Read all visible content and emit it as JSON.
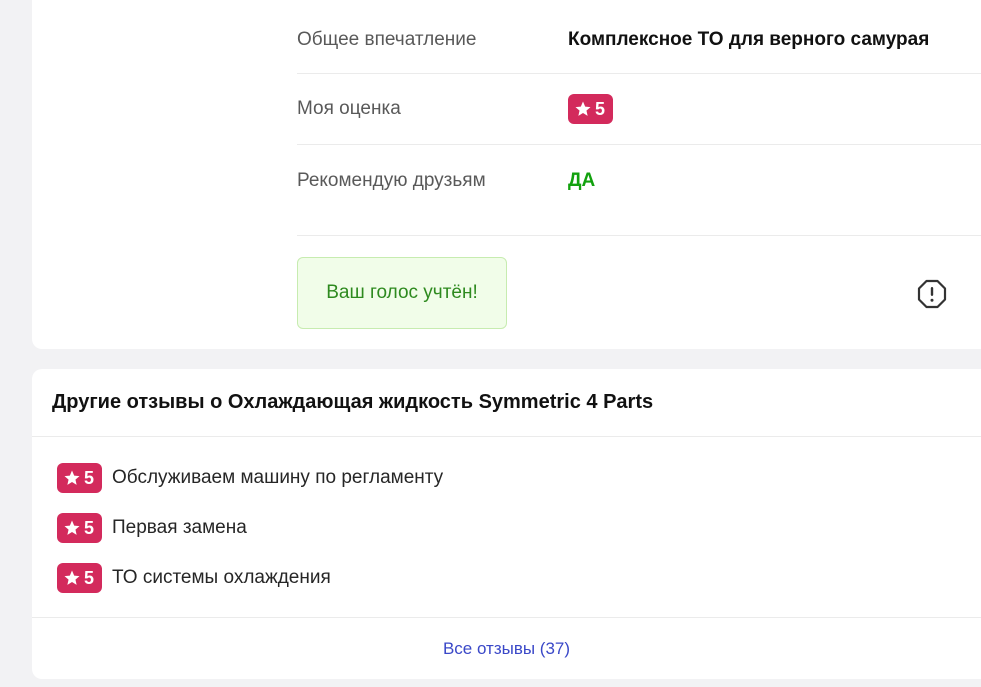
{
  "details": {
    "impression_label": "Общее впечатление",
    "impression_value": "Комплексное ТО для верного самурая",
    "rating_label": "Моя оценка",
    "rating_value": "5",
    "recommend_label": "Рекомендую друзьям",
    "recommend_value": "ДА"
  },
  "vote": {
    "message": "Ваш голос учтён!"
  },
  "icons": {
    "star": "star-icon",
    "report": "report-icon"
  },
  "colors": {
    "badge": "#d32a5c",
    "yes": "#12a10e",
    "vote_bg": "#f1fde9",
    "link": "#3a48c8"
  },
  "other_reviews": {
    "title": "Другие отзывы о Охлаждающая жидкость Symmetric 4 Parts",
    "items": [
      {
        "rating": "5",
        "title": "Обслуживаем машину по регламенту"
      },
      {
        "rating": "5",
        "title": "Первая замена"
      },
      {
        "rating": "5",
        "title": "ТО системы охлаждения"
      }
    ],
    "all_link": "Все отзывы (37)"
  }
}
